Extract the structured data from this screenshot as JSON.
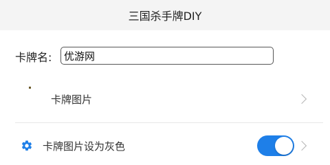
{
  "header": {
    "title": "三国杀手牌DIY"
  },
  "card_name": {
    "label": "卡牌名:",
    "value": "优游网"
  },
  "card_image_row": {
    "label": "卡牌图片",
    "chevron_icon": "chevron-right-icon"
  },
  "gray_row": {
    "icon": "gear-icon",
    "label": "卡牌图片设为灰色",
    "toggle_on": true,
    "chevron_icon": "chevron-right-icon"
  },
  "colors": {
    "accent": "#1e7fe8",
    "header_bg": "#f4f4f4",
    "chevron": "#b5b5b5"
  }
}
